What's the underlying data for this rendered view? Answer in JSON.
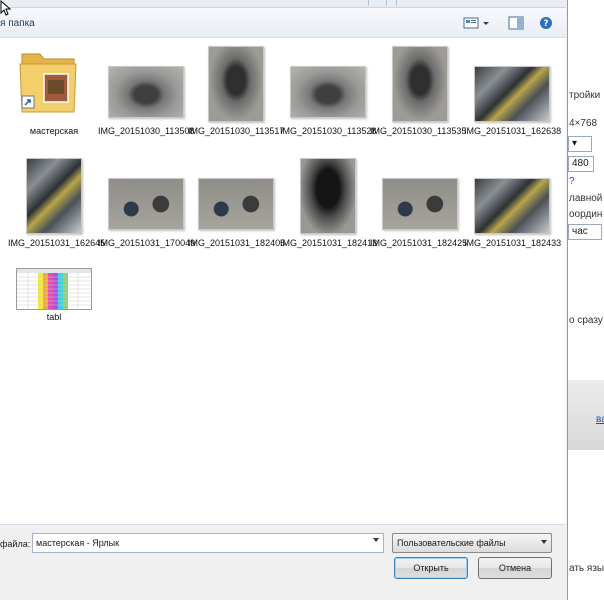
{
  "toolbar": {
    "new_folder_label": "я папка",
    "icons": [
      "view-menu-icon",
      "chevron-down-icon",
      "preview-pane-icon",
      "help-icon"
    ]
  },
  "items": [
    {
      "name": "мастерская",
      "kind": "folder-shortcut"
    },
    {
      "name": "IMG_20151030_113508",
      "kind": "photo"
    },
    {
      "name": "IMG_20151030_113517",
      "kind": "photo"
    },
    {
      "name": "IMG_20151030_113528",
      "kind": "photo"
    },
    {
      "name": "IMG_20151030_113535",
      "kind": "photo"
    },
    {
      "name": "IMG_20151031_162638",
      "kind": "photo"
    },
    {
      "name": "IMG_20151031_162645",
      "kind": "photo"
    },
    {
      "name": "IMG_20151031_170049",
      "kind": "photo"
    },
    {
      "name": "IMG_20151031_182405",
      "kind": "photo"
    },
    {
      "name": "IMG_20151031_182413",
      "kind": "photo"
    },
    {
      "name": "IMG_20151031_182425",
      "kind": "photo"
    },
    {
      "name": "IMG_20151031_182433",
      "kind": "photo"
    },
    {
      "name": "tabl",
      "kind": "spreadsheet"
    }
  ],
  "footer": {
    "filename_label": "файла:",
    "filename_value": "мастерская - Ярлык",
    "filetype_value": "Пользовательские файлы",
    "open_label": "Открыть",
    "cancel_label": "Отмена"
  },
  "background_page": {
    "fragments": [
      "тройки",
      "4×768",
      "480",
      "час",
      "лавной",
      "оордин",
      "о сразу",
      "ва",
      "ать язы"
    ]
  },
  "colors": {
    "accent": "#3c7fb1",
    "link": "#1a57b0"
  }
}
